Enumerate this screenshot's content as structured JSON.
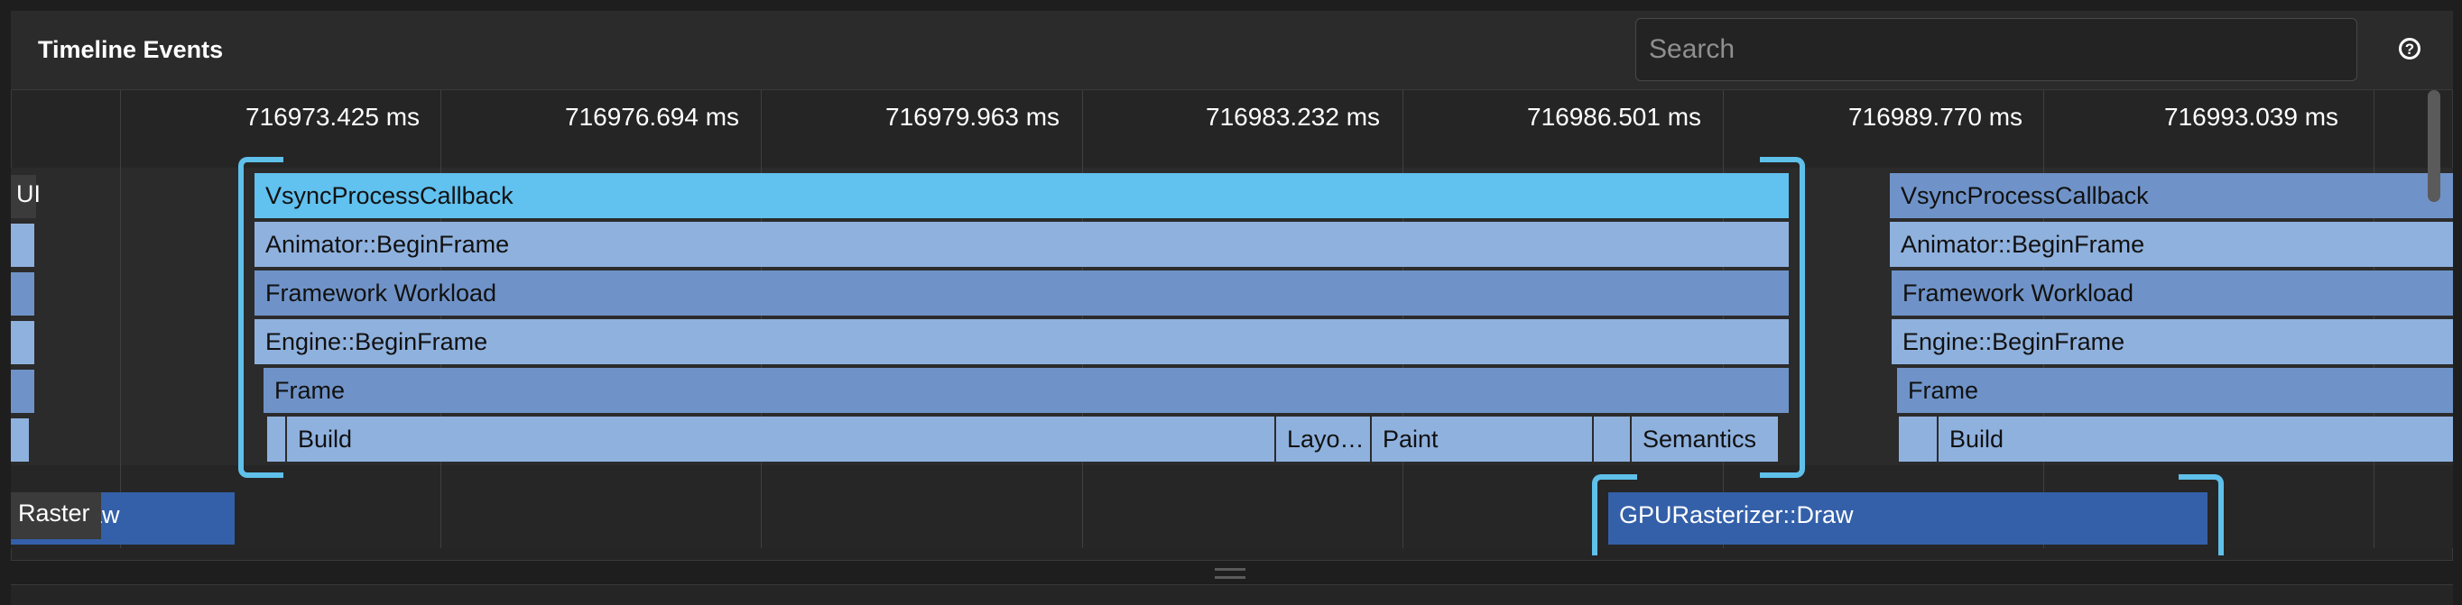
{
  "header": {
    "title": "Timeline Events",
    "search_placeholder": "Search",
    "help_icon": "help-circle-icon"
  },
  "ruler": {
    "ticks": [
      "716973.425 ms",
      "716976.694 ms",
      "716979.963 ms",
      "716983.232 ms",
      "716986.501 ms",
      "716989.770 ms",
      "716993.039 ms"
    ]
  },
  "rows": {
    "ui_label": "UI",
    "raster_label": "Raster"
  },
  "frame1": {
    "vsync": "VsyncProcessCallback",
    "animator": "Animator::BeginFrame",
    "framework": "Framework Workload",
    "engine": "Engine::BeginFrame",
    "frame": "Frame",
    "build": "Build",
    "layout": "Layo…",
    "paint": "Paint",
    "semantics": "Semantics"
  },
  "frame2": {
    "vsync": "VsyncProcessCallback",
    "animator": "Animator::BeginFrame",
    "framework": "Framework Workload",
    "engine": "Engine::BeginFrame",
    "frame": "Frame",
    "build": "Build"
  },
  "raster": {
    "prev_draw": "aw",
    "gpu_draw": "GPURasterizer::Draw"
  },
  "colors": {
    "vsync": "#61c1ef",
    "light": "#8fb1de",
    "mid": "#6f93c8",
    "raster": "#3460a9",
    "selection_bracket": "#5fc0ea"
  }
}
